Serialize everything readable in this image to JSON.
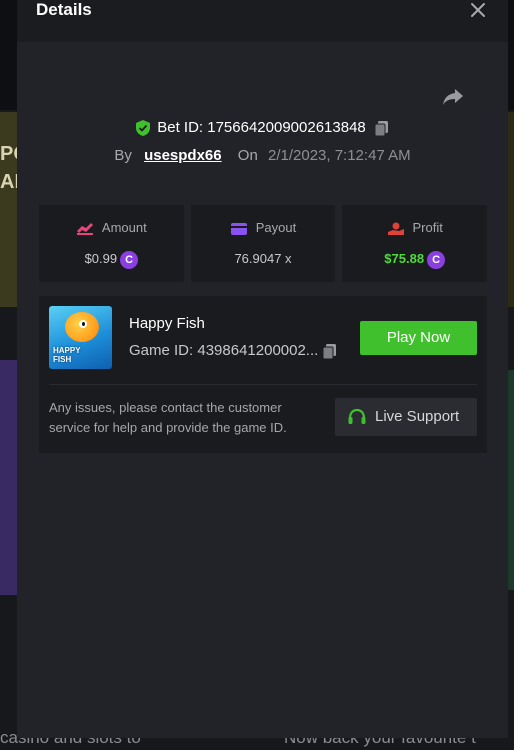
{
  "background": {
    "left_text": "PO\nAR",
    "bottom_left": "casino and slots to",
    "bottom_right": "Now back your favourite t"
  },
  "modal": {
    "title": "Details",
    "bet_label": "Bet ID:",
    "bet_id": "1756642009002613848",
    "by_label": "By",
    "username": "usespdx66",
    "on_label": "On",
    "date": "2/1/2023, 7:12:47 AM"
  },
  "stats": [
    {
      "label": "Amount",
      "value": "$0.99",
      "icon": "amount-icon"
    },
    {
      "label": "Payout",
      "value": "76.9047 x",
      "icon": "payout-icon"
    },
    {
      "label": "Profit",
      "value": "$75.88",
      "icon": "profit-icon"
    }
  ],
  "currency_symbol": "C",
  "game": {
    "name": "Happy Fish",
    "id_label": "Game ID:",
    "id": "4398641200002...",
    "thumb_label": "HAPPY\nFISH",
    "play_label": "Play Now"
  },
  "help": {
    "text": "Any issues, please contact the customer service for help and provide the game ID.",
    "support_label": "Live Support"
  },
  "colors": {
    "accent_green": "#3fc02c",
    "profit_green": "#4ddc3a",
    "coin_purple": "#8a3fe0",
    "modal_bg": "#222328"
  }
}
